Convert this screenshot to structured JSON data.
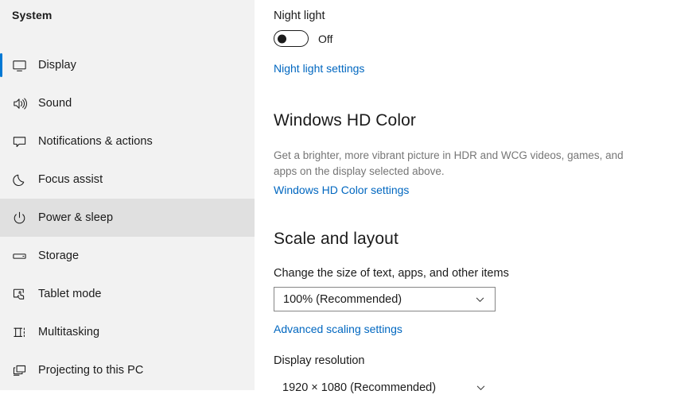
{
  "sidebar": {
    "title": "System",
    "items": [
      {
        "label": "Display",
        "icon": "monitor-icon",
        "selected": true,
        "hover": false
      },
      {
        "label": "Sound",
        "icon": "speaker-icon",
        "selected": false,
        "hover": false
      },
      {
        "label": "Notifications & actions",
        "icon": "chat-bubble-icon",
        "selected": false,
        "hover": false
      },
      {
        "label": "Focus assist",
        "icon": "moon-icon",
        "selected": false,
        "hover": false
      },
      {
        "label": "Power & sleep",
        "icon": "power-icon",
        "selected": false,
        "hover": true
      },
      {
        "label": "Storage",
        "icon": "drive-icon",
        "selected": false,
        "hover": false
      },
      {
        "label": "Tablet mode",
        "icon": "tablet-hand-icon",
        "selected": false,
        "hover": false
      },
      {
        "label": "Multitasking",
        "icon": "multitasking-icon",
        "selected": false,
        "hover": false
      },
      {
        "label": "Projecting to this PC",
        "icon": "project-screen-icon",
        "selected": false,
        "hover": false
      }
    ]
  },
  "content": {
    "night_light": {
      "label": "Night light",
      "toggle_state": "Off",
      "settings_link": "Night light settings"
    },
    "hd_color": {
      "heading": "Windows HD Color",
      "description": "Get a brighter, more vibrant picture in HDR and WCG videos, games, and apps on the display selected above.",
      "settings_link": "Windows HD Color settings"
    },
    "scale_layout": {
      "heading": "Scale and layout",
      "scale_label": "Change the size of text, apps, and other items",
      "scale_value": "100% (Recommended)",
      "advanced_link": "Advanced scaling settings",
      "resolution_label": "Display resolution",
      "resolution_value": "1920 × 1080 (Recommended)"
    }
  },
  "colors": {
    "accent": "#0078d4",
    "link": "#0067c0",
    "sidebar_bg": "#f2f2f2",
    "hover_bg": "#e0e0e0",
    "text": "#1b1b1b",
    "muted_text": "#767676",
    "border": "#868686"
  }
}
